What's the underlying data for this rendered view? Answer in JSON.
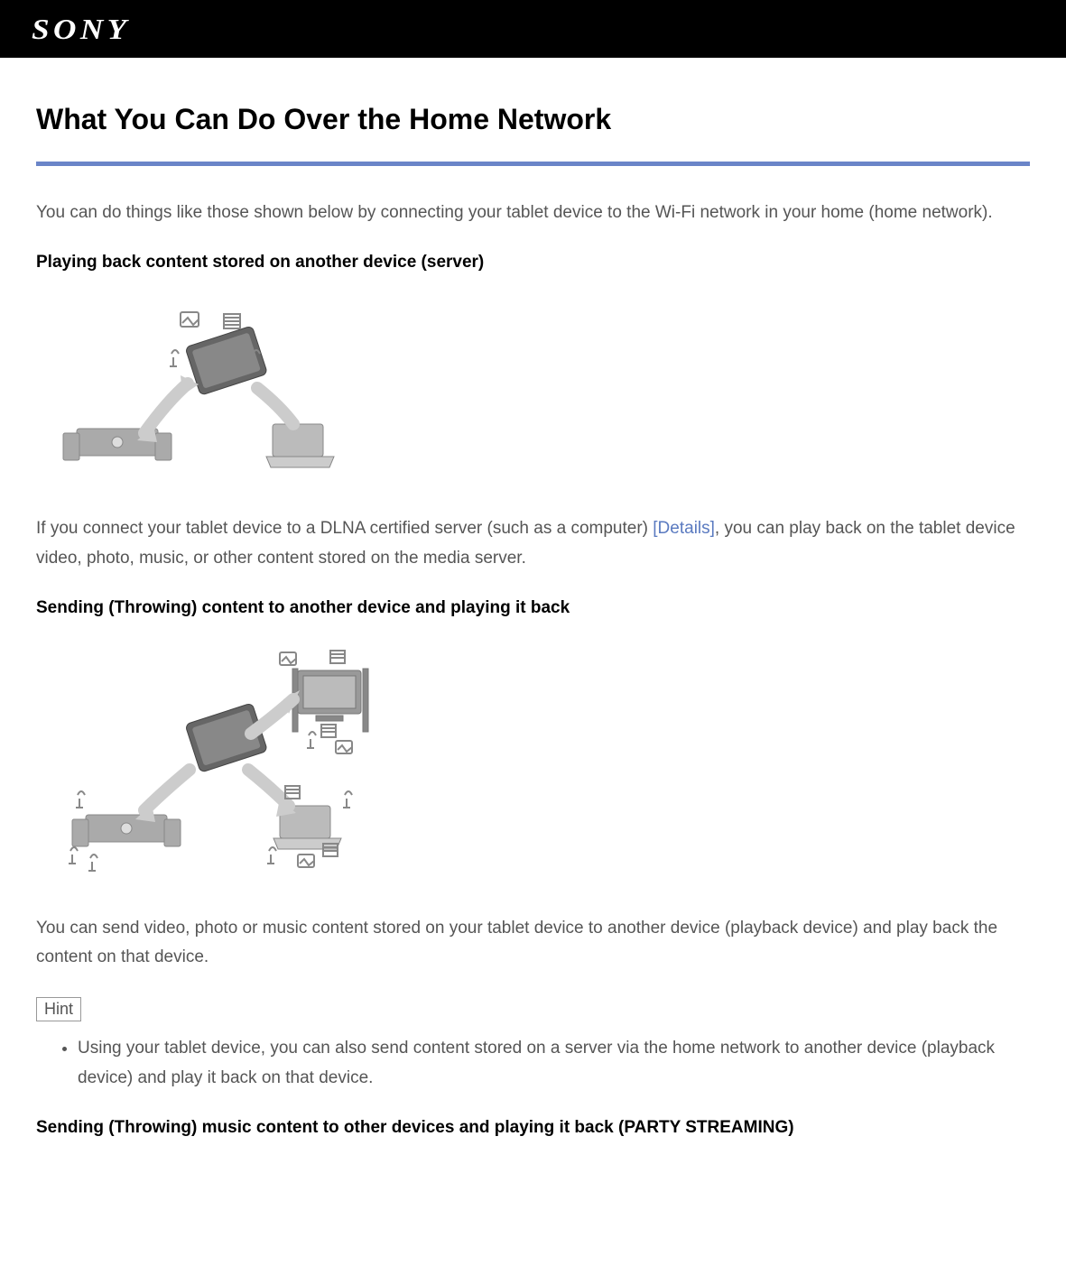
{
  "brand": "SONY",
  "page_title": "What You Can Do Over the Home Network",
  "intro": "You can do things like those shown below by connecting your tablet device to the Wi-Fi network in your home (home network).",
  "section1": {
    "heading": "Playing back content stored on another device (server)",
    "body_prefix": "If you connect your tablet device to a DLNA certified server (such as a computer) ",
    "details_link": "[Details]",
    "body_suffix": ", you can play back on the tablet device video, photo, music, or other content stored on the media server."
  },
  "section2": {
    "heading": "Sending (Throwing) content to another device and playing it back",
    "body": "You can send video, photo or music content stored on your tablet device to another device (playback device) and play back the content on that device."
  },
  "hint": {
    "label": "Hint",
    "item": "Using your tablet device, you can also send content stored on a server via the home network to another device (playback device) and play it back on that device."
  },
  "section3": {
    "heading": "Sending (Throwing) music content to other devices and playing it back (PARTY STREAMING)"
  }
}
